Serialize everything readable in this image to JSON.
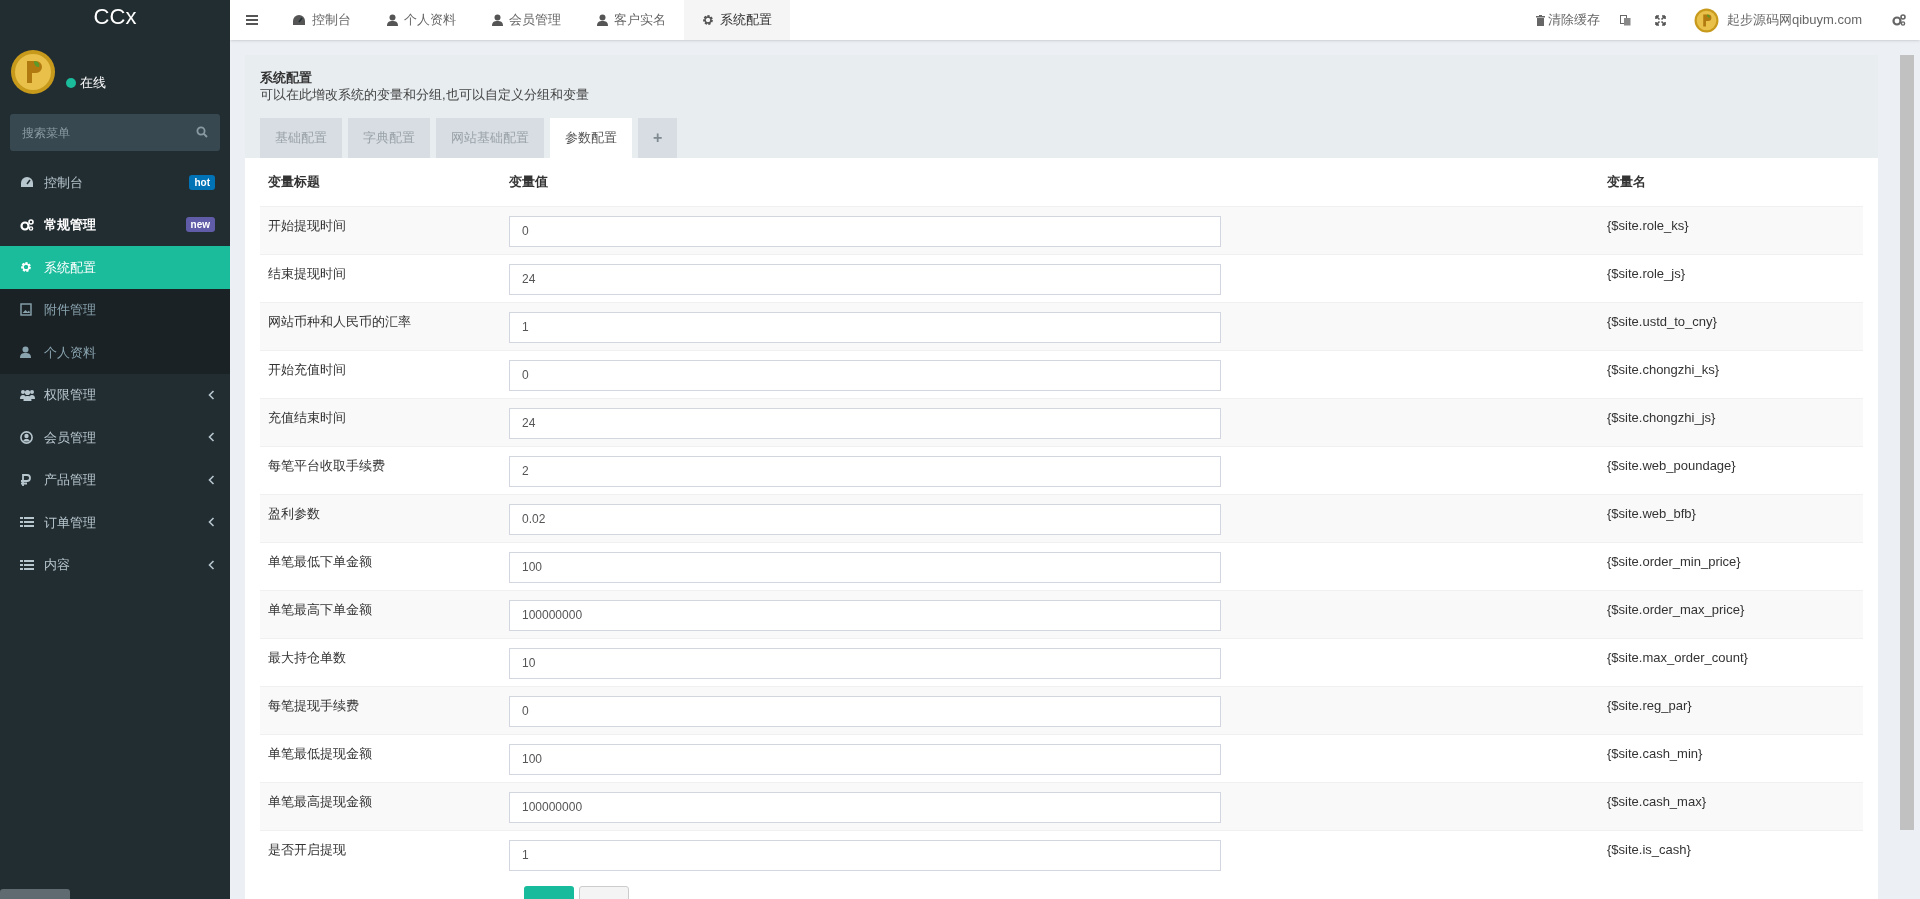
{
  "sidebar": {
    "logo": "CCx",
    "user": {
      "status": "在线",
      "online": true
    },
    "search": {
      "placeholder": "搜索菜单"
    },
    "items": [
      {
        "label": "控制台",
        "kind": "link",
        "badge": {
          "text": "hot",
          "color": "#0073b7"
        },
        "selected": false
      },
      {
        "label": "常规管理",
        "kind": "group",
        "badge": {
          "text": "new",
          "color": "#605ca8"
        },
        "expanded": true,
        "selected": false,
        "children": [
          {
            "label": "系统配置",
            "selected": true
          },
          {
            "label": "附件管理",
            "selected": false
          },
          {
            "label": "个人资料",
            "selected": false
          }
        ]
      },
      {
        "label": "权限管理",
        "kind": "group",
        "expanded": false,
        "selected": false
      },
      {
        "label": "会员管理",
        "kind": "group",
        "expanded": false,
        "selected": false
      },
      {
        "label": "产品管理",
        "kind": "group",
        "expanded": false,
        "selected": false
      },
      {
        "label": "订单管理",
        "kind": "group",
        "expanded": false,
        "selected": false
      },
      {
        "label": "内容",
        "kind": "group",
        "expanded": false,
        "selected": false
      }
    ]
  },
  "top_tabs": [
    {
      "label": "控制台",
      "selected": false
    },
    {
      "label": "个人资料",
      "selected": false
    },
    {
      "label": "会员管理",
      "selected": false
    },
    {
      "label": "客户实名",
      "selected": false
    },
    {
      "label": "系统配置",
      "selected": true
    }
  ],
  "top_right": {
    "clear_cache": "清除缓存",
    "user": "起步源码网qibuym.com"
  },
  "panel": {
    "title": "系统配置",
    "subtitle": "可以在此增改系统的变量和分组,也可以自定义分组和变量",
    "tabs": [
      {
        "label": "基础配置",
        "selected": false
      },
      {
        "label": "字典配置",
        "selected": false
      },
      {
        "label": "网站基础配置",
        "selected": false
      },
      {
        "label": "参数配置",
        "selected": true
      },
      {
        "label": "+",
        "selected": false
      }
    ],
    "columns": [
      "变量标题",
      "变量值",
      "变量名"
    ],
    "rows": [
      {
        "title": "开始提现时间",
        "value": "0",
        "name": "{$site.role_ks}"
      },
      {
        "title": "结束提现时间",
        "value": "24",
        "name": "{$site.role_js}"
      },
      {
        "title": "网站币种和人民币的汇率",
        "value": "1",
        "name": "{$site.ustd_to_cny}"
      },
      {
        "title": "开始充值时间",
        "value": "0",
        "name": "{$site.chongzhi_ks}"
      },
      {
        "title": "充值结束时间",
        "value": "24",
        "name": "{$site.chongzhi_js}"
      },
      {
        "title": "每笔平台收取手续费",
        "value": "2",
        "name": "{$site.web_poundage}"
      },
      {
        "title": "盈利参数",
        "value": "0.02",
        "name": "{$site.web_bfb}"
      },
      {
        "title": "单笔最低下单金额",
        "value": "100",
        "name": "{$site.order_min_price}"
      },
      {
        "title": "单笔最高下单金额",
        "value": "100000000",
        "name": "{$site.order_max_price}"
      },
      {
        "title": "最大持仓单数",
        "value": "10",
        "name": "{$site.max_order_count}"
      },
      {
        "title": "每笔提现手续费",
        "value": "0",
        "name": "{$site.reg_par}"
      },
      {
        "title": "单笔最低提现金额",
        "value": "100",
        "name": "{$site.cash_min}"
      },
      {
        "title": "单笔最高提现金额",
        "value": "100000000",
        "name": "{$site.cash_max}"
      },
      {
        "title": "是否开启提现",
        "value": "1",
        "name": "{$site.is_cash}"
      }
    ]
  }
}
